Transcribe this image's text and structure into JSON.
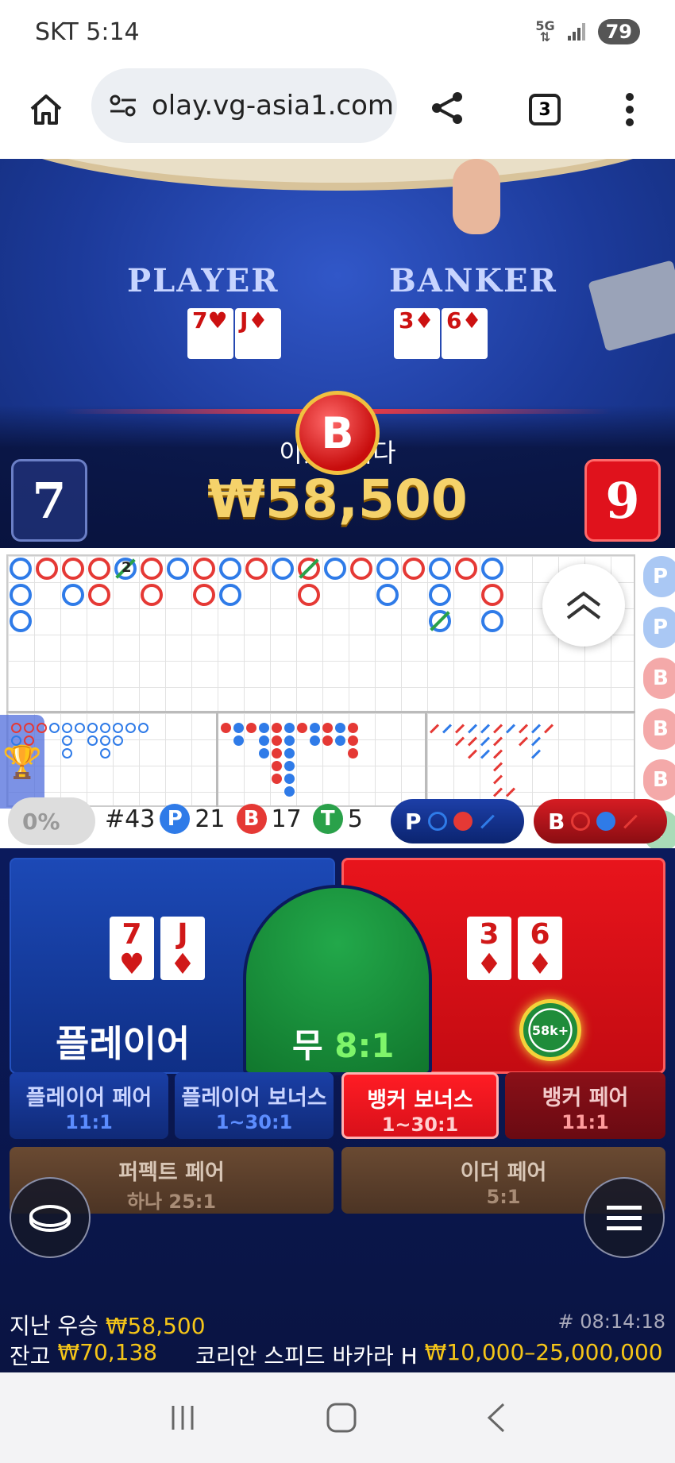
{
  "status_bar": {
    "carrier_time": "SKT 5:14",
    "network": "5G",
    "battery": "79"
  },
  "browser": {
    "url": "olay.vg-asia1.com",
    "tab_count": "3"
  },
  "video": {
    "player_label": "PLAYER",
    "banker_label": "BANKER",
    "player_cards": [
      "7♥",
      "J♦"
    ],
    "banker_cards": [
      "3♦",
      "6♦"
    ],
    "win_badge": "B",
    "win_title": "이겼습니다",
    "win_amount": "₩58,500",
    "player_score": "7",
    "banker_score": "9"
  },
  "stats": {
    "percent": "0%",
    "round": "#43",
    "player_letter": "P",
    "player_count": "21",
    "banker_letter": "B",
    "banker_count": "17",
    "tie_letter": "T",
    "tie_count": "5",
    "ask_player": "P",
    "ask_banker": "B"
  },
  "sidebar_pills": [
    "P",
    "P",
    "B",
    "B",
    "B",
    "T"
  ],
  "bead_marker": "2",
  "bets": {
    "player_label": "플레이어",
    "player_cards": [
      {
        "rank": "7",
        "suit": "♥"
      },
      {
        "rank": "J",
        "suit": "♦"
      }
    ],
    "tie_label": "무",
    "tie_odds": "8:1",
    "banker_cards": [
      {
        "rank": "3",
        "suit": "♦"
      },
      {
        "rank": "6",
        "suit": "♦"
      }
    ],
    "chip_value": "58k+",
    "player_pair": "플레이어 페어",
    "player_pair_odds": "11:1",
    "player_bonus": "플레이어 보너스",
    "player_bonus_odds": "1~30:1",
    "banker_bonus": "뱅커 보너스",
    "banker_bonus_odds": "1~30:1",
    "banker_pair": "뱅커 페어",
    "banker_pair_odds": "11:1",
    "perfect_pair": "퍼펙트 페어",
    "perfect_pair_odds": "하나 25:1",
    "either_pair": "이더 페어",
    "either_pair_odds": "5:1"
  },
  "footer": {
    "last_win_label": "지난 우승",
    "last_win_amount": "₩58,500",
    "timecode": "# 08:14:18",
    "balance_label": "잔고",
    "balance_amount": "₩70,138",
    "table_name": "코리안 스피드 바카라 H",
    "limits": "₩10,000–25,000,000"
  },
  "colors": {
    "player_blue": "#2f7be8",
    "banker_red": "#e53935",
    "tie_green": "#2aa14a",
    "gold": "#f5c518"
  }
}
